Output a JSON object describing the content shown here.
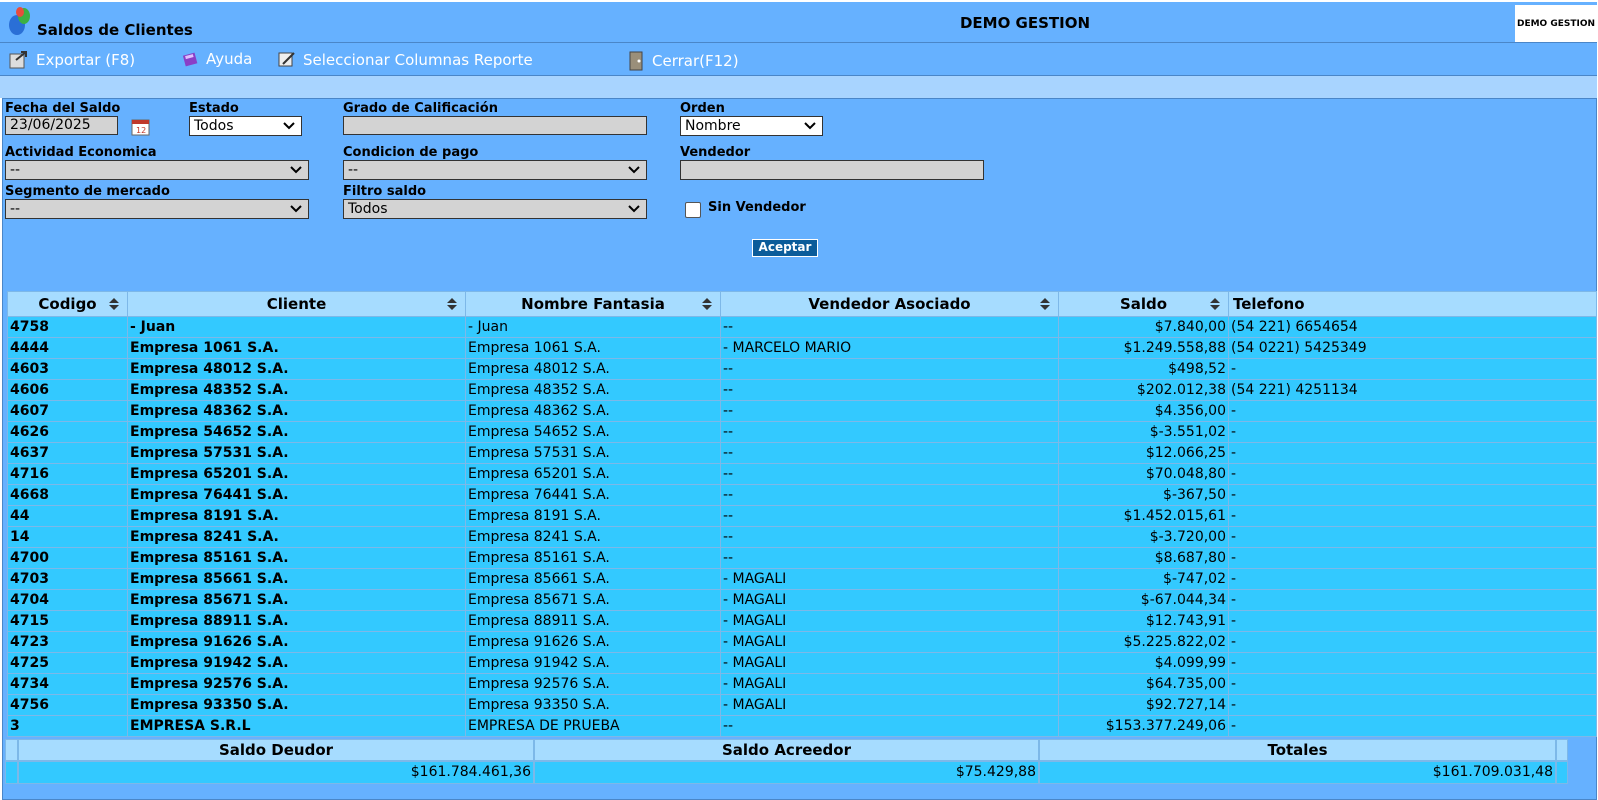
{
  "app": {
    "title": "Saldos de Clientes",
    "company": "DEMO GESTION",
    "logo_text": "DEMO GESTION"
  },
  "toolbar": {
    "export": "Exportar (F8)",
    "help": "Ayuda",
    "columns": "Seleccionar Columnas Reporte",
    "close": "Cerrar(F12)"
  },
  "filters": {
    "fecha_label": "Fecha del Saldo",
    "fecha_value": "23/06/2025",
    "estado_label": "Estado",
    "estado_value": "Todos",
    "grado_label": "Grado de Calificación",
    "grado_value": "",
    "orden_label": "Orden",
    "orden_value": "Nombre",
    "actividad_label": "Actividad Economica",
    "actividad_value": "--",
    "condicion_label": "Condicion de pago",
    "condicion_value": "--",
    "vendedor_label": "Vendedor",
    "vendedor_value": "",
    "segmento_label": "Segmento de mercado",
    "segmento_value": "--",
    "filtro_label": "Filtro saldo",
    "filtro_value": "Todos",
    "sin_vendedor_label": "Sin Vendedor",
    "accept": "Aceptar"
  },
  "table": {
    "headers": [
      "Codigo",
      "Cliente",
      "Nombre Fantasia",
      "Vendedor Asociado",
      "Saldo",
      "Telefono"
    ],
    "rows": [
      [
        "4758",
        "- Juan",
        "- Juan",
        "--",
        "$7.840,00",
        "(54 221) 6654654"
      ],
      [
        "4444",
        "Empresa 1061 S.A.",
        "Empresa 1061 S.A.",
        "- MARCELO MARIO",
        "$1.249.558,88",
        "(54 0221) 5425349"
      ],
      [
        "4603",
        "Empresa 48012 S.A.",
        "Empresa 48012 S.A.",
        "--",
        "$498,52",
        "-"
      ],
      [
        "4606",
        "Empresa 48352 S.A.",
        "Empresa 48352 S.A.",
        "--",
        "$202.012,38",
        "(54 221) 4251134"
      ],
      [
        "4607",
        "Empresa 48362 S.A.",
        "Empresa 48362 S.A.",
        "--",
        "$4.356,00",
        "-"
      ],
      [
        "4626",
        "Empresa 54652 S.A.",
        "Empresa 54652 S.A.",
        "--",
        "$-3.551,02",
        "-"
      ],
      [
        "4637",
        "Empresa 57531 S.A.",
        "Empresa 57531 S.A.",
        "--",
        "$12.066,25",
        "-"
      ],
      [
        "4716",
        "Empresa 65201 S.A.",
        "Empresa 65201 S.A.",
        "--",
        "$70.048,80",
        "-"
      ],
      [
        "4668",
        "Empresa 76441 S.A.",
        "Empresa 76441 S.A.",
        "--",
        "$-367,50",
        "-"
      ],
      [
        "44",
        "Empresa 8191 S.A.",
        "Empresa 8191 S.A.",
        "--",
        "$1.452.015,61",
        "-"
      ],
      [
        "14",
        "Empresa 8241 S.A.",
        "Empresa 8241 S.A.",
        "--",
        "$-3.720,00",
        "-"
      ],
      [
        "4700",
        "Empresa 85161 S.A.",
        "Empresa 85161 S.A.",
        "--",
        "$8.687,80",
        "-"
      ],
      [
        "4703",
        "Empresa 85661 S.A.",
        "Empresa 85661 S.A.",
        "- MAGALI",
        "$-747,02",
        "-"
      ],
      [
        "4704",
        "Empresa 85671 S.A.",
        "Empresa 85671 S.A.",
        "- MAGALI",
        "$-67.044,34",
        "-"
      ],
      [
        "4715",
        "Empresa 88911 S.A.",
        "Empresa 88911 S.A.",
        "- MAGALI",
        "$12.743,91",
        "-"
      ],
      [
        "4723",
        "Empresa 91626 S.A.",
        "Empresa 91626 S.A.",
        "- MAGALI",
        "$5.225.822,02",
        "-"
      ],
      [
        "4725",
        "Empresa 91942 S.A.",
        "Empresa 91942 S.A.",
        "- MAGALI",
        "$4.099,99",
        "-"
      ],
      [
        "4734",
        "Empresa 92576 S.A.",
        "Empresa 92576 S.A.",
        "- MAGALI",
        "$64.735,00",
        "-"
      ],
      [
        "4756",
        "Empresa 93350 S.A.",
        "Empresa 93350 S.A.",
        "- MAGALI",
        "$92.727,14",
        "-"
      ],
      [
        "3",
        "EMPRESA S.R.L",
        "EMPRESA DE PRUEBA",
        "--",
        "$153.377.249,06",
        "-"
      ]
    ]
  },
  "totals": {
    "deudor_label": "Saldo Deudor",
    "deudor_value": "$161.784.461,36",
    "acreedor_label": "Saldo Acreedor",
    "acreedor_value": "$75.429,88",
    "totales_label": "Totales",
    "totales_value": "$161.709.031,48"
  },
  "colors": {
    "panel": "#66b1ff",
    "row": "#33c9ff",
    "header": "#a6dcff",
    "button": "#0b5c9a"
  }
}
